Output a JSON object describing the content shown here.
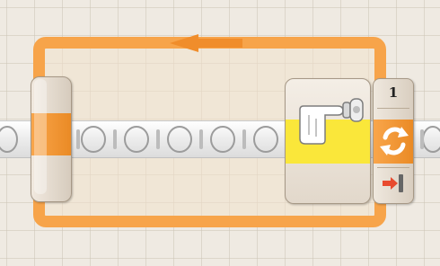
{
  "loop": {
    "port_number": "1",
    "colors": {
      "loop_orange": "#f7a44a",
      "sensor_yellow": "#fae73a",
      "block_beige": "#efe8de",
      "beam_white": "#f2f2f2"
    },
    "icons": {
      "sensor": "touch-sensor-icon",
      "condition": "loop-refresh-icon",
      "control": "stop-arrow-icon"
    }
  }
}
